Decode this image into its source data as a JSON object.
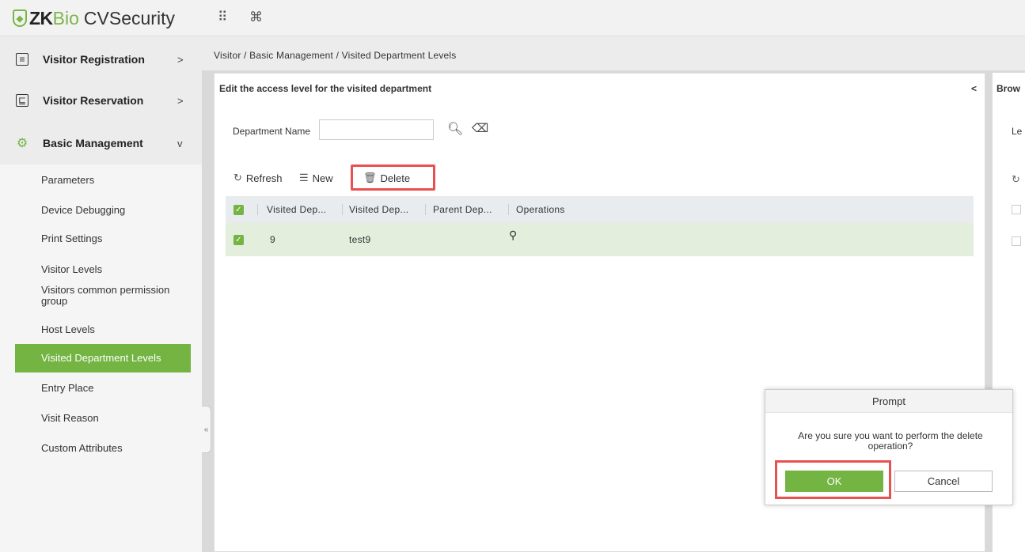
{
  "app": {
    "logo_brand": "ZK",
    "logo_brand2": "Bio",
    "logo_product": "CVSecurity"
  },
  "header": {
    "apps_icon": "grid-icon",
    "cmd_icon": "command-icon"
  },
  "sidebar": {
    "groups": [
      {
        "label": "Visitor Registration",
        "icon": "registration-icon",
        "chevron": ">"
      },
      {
        "label": "Visitor Reservation",
        "icon": "reservation-icon",
        "chevron": ">"
      },
      {
        "label": "Basic Management",
        "icon": "management-icon",
        "chevron": "v"
      }
    ],
    "items": [
      {
        "label": "Parameters"
      },
      {
        "label": "Device Debugging"
      },
      {
        "label": "Print Settings"
      },
      {
        "label": "Visitor Levels"
      },
      {
        "label": "Visitors common permission group"
      },
      {
        "label": "Host Levels"
      },
      {
        "label": "Visited Department Levels",
        "active": true
      },
      {
        "label": "Entry Place"
      },
      {
        "label": "Visit Reason"
      },
      {
        "label": "Custom Attributes"
      }
    ],
    "collapse_glyph": "«"
  },
  "breadcrumb": "Visitor / Basic Management / Visited Department Levels",
  "panel": {
    "title": "Edit the access level for the visited department",
    "collapse_glyph": "<",
    "search": {
      "label": "Department Name",
      "value": ""
    },
    "toolbar": {
      "refresh": "Refresh",
      "new": "New",
      "delete": "Delete"
    },
    "columns": [
      "Visited Dep...",
      "Visited Dep...",
      "Parent Dep...",
      "Operations"
    ],
    "rows": [
      {
        "col1": "9",
        "col2": "test9",
        "col3": ""
      }
    ]
  },
  "right_panel": {
    "title": "Brow",
    "label": "Le"
  },
  "dialog": {
    "title": "Prompt",
    "message": "Are you sure you want to perform the delete operation?",
    "ok": "OK",
    "cancel": "Cancel"
  },
  "colors": {
    "accent": "#73b442",
    "highlight": "#e8514f"
  }
}
